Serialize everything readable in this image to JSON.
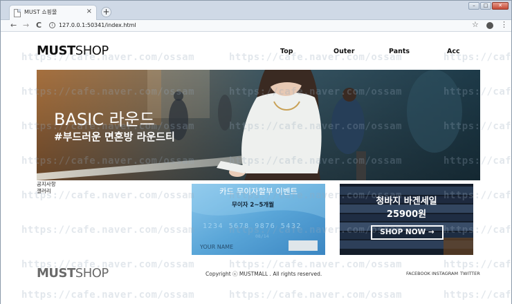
{
  "browser": {
    "tab_title": "MUST 쇼핑몰",
    "tab_close": "×",
    "new_tab": "+",
    "url": "127.0.0.1:50341/index.html",
    "back": "←",
    "forward": "→",
    "reload": "C",
    "info": "i",
    "star": "☆",
    "menu": "⋮",
    "window_buttons": [
      "–",
      "□",
      "✕"
    ]
  },
  "header": {
    "logo_must": "MUST",
    "logo_shop": "SHOP",
    "nav": [
      "Top",
      "Outer",
      "Pants",
      "Acc"
    ]
  },
  "banner": {
    "title": "BASIC 라운드",
    "subtitle": "#부드러운 면혼방 라운드티"
  },
  "sidebar_links": [
    "공지사항",
    "갤러리"
  ],
  "card_event": {
    "title": "카드 무이자할부 이벤트",
    "subtitle": "무이자 2~5개월",
    "card_number": "1234 5678 9876 5432",
    "card_small": "08/14",
    "card_name": "YOUR NAME"
  },
  "jeans_sale": {
    "title": "청바지 바겐세일",
    "price": "25900원",
    "button": "SHOP NOW →"
  },
  "footer": {
    "logo_must": "MUST",
    "logo_shop": "SHOP",
    "copyright": "Copyright ⓒ MUSTMALL . All rights reserved.",
    "social": [
      "FACEBOOK",
      "INSTAGRAM",
      "TWITTER"
    ]
  },
  "watermark": "https://cafe.naver.com/ossam",
  "colors": {
    "card_blue": "#62a9da",
    "banner_teal": "#2e4452",
    "jeans_navy": "#1d2a3b"
  }
}
